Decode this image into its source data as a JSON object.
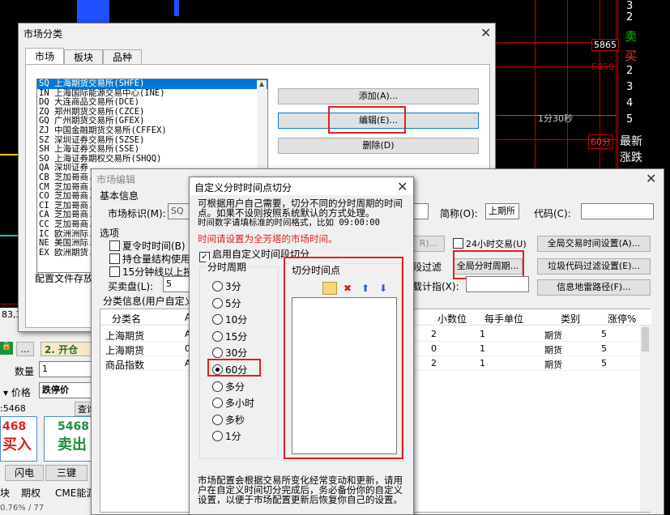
{
  "background": {
    "right_panel": [
      "3",
      "2",
      "卖",
      "买",
      "2",
      "3",
      "4",
      "5",
      "最新",
      "涨跌"
    ],
    "price_5865": "5865",
    "price_5850": "5850",
    "label_1fen30miao": "1分30秒",
    "label_60fen": "60分",
    "left_labels": {
      "price_83": "83,3",
      "kaicang": "2. 开仓",
      "shuliang": "数量",
      "shuliang_val": "1",
      "jiage": "价格",
      "jiage_val": "跌停价",
      "price_5468": ":5468",
      "chaxun": "查询",
      "red_price": "468",
      "green_price": "5468",
      "mairu": "买入",
      "maichu": "卖出",
      "shandian": "闪电",
      "sanjian": "三键",
      "kuai": "块",
      "qiquan": "期权",
      "cme": "CME能源",
      "bottom_pct": "0.76% / 77"
    }
  },
  "market_window": {
    "title": "市场分类",
    "tabs": [
      "市场",
      "板块",
      "品种"
    ],
    "list": [
      "SQ 上海期货交易所(SHFE)",
      "IN 上海国际能源交易中心(INE)",
      "DQ 大连商品交易所(DCE)",
      "ZQ 郑州期货交易所(CZCE)",
      "GQ 广州期货交易所(GFEX)",
      "ZJ 中国金融期货交易所(CFFEX)",
      "SZ 深圳证券交易所(SZSE)",
      "SH 上海证券交易所(SSE)",
      "SO 上海证券期权交易所(SHQQ)",
      "QA 深圳证券...",
      "CB 芝加哥商...",
      "CM 芝加哥商...",
      "CO 芝加哥商...",
      "CI 芝加哥商...",
      "CA 芝加哥商...",
      "CC 芝加哥商...",
      "IC 欧洲洲际...",
      "NE 美国洲际...",
      "EX 欧洲期货..."
    ],
    "add_btn": "添加(A)...",
    "edit_btn": "编辑(E)...",
    "delete_btn": "删除(D)",
    "config_label": "配置文件存放"
  },
  "edit_window": {
    "title": "市场编辑",
    "basic_info": "基本信息",
    "market_id_label": "市场标识(M):",
    "market_id_val": "SQ",
    "short_name_label": "简称(O):",
    "short_name_val": "上期所",
    "code_label": "代码(C):",
    "code_val": "",
    "options_label": "选项",
    "opt_summer": "夏令时时间(B)",
    "opt_position": "持仓量结构使用",
    "opt_15min": "15分钟线以上按",
    "buy_sell_label": "买卖盘(L):",
    "buy_sell_val": "5",
    "r_btn": "R)...",
    "opt_24h": "24小时交易(U)",
    "global_time_btn": "全局交易时间设置(A)...",
    "filter_label": "段过滤",
    "global_split_btn": "全局分时周期...",
    "junk_filter_btn": "垃圾代码过滤设置(E)...",
    "index_label": "载计指(X):",
    "info_path_btn": "信息地雷路径(F)...",
    "class_info_label": "分类信息(用户自定义",
    "columns": [
      "分类名",
      "A",
      "小数位",
      "每手单位",
      "类别",
      "涨停%"
    ],
    "rows": [
      [
        "上海期货",
        "AU",
        "2",
        "1",
        "期货",
        "5"
      ],
      [
        "上海期货",
        "0",
        "0",
        "1",
        "期货",
        "5"
      ],
      [
        "商品指数",
        "AU",
        "2",
        "1",
        "期货",
        "5"
      ]
    ]
  },
  "dialog": {
    "title": "自定义分时时间点切分",
    "desc1": "可根据用户自己需要，切分不同的分时周期的时间点。如果不设则按照系统默认的方式处理。",
    "desc2": "时间数字请填标准的时间格式，比如 09:00:00",
    "desc_red": "时间请设置为全芳塔的市场时间。",
    "enable_label": "启用自定义时间段切分",
    "period_group": "分时周期",
    "periods": [
      "3分",
      "5分",
      "10分",
      "15分",
      "30分",
      "60分",
      "多分",
      "多小时",
      "多秒",
      "1分"
    ],
    "selected_period": "60分",
    "split_group": "切分时间点",
    "footer": "市场配置会根据交易所变化经常变动和更新，请用户在自定义时间切分完成后，务必备份你的自定义设置，以便于市场配置更新后恢复你自己的设置。"
  },
  "colors": {
    "accent_red": "#e02020",
    "selection": "#0078d7",
    "chart_red": "#c00000"
  }
}
